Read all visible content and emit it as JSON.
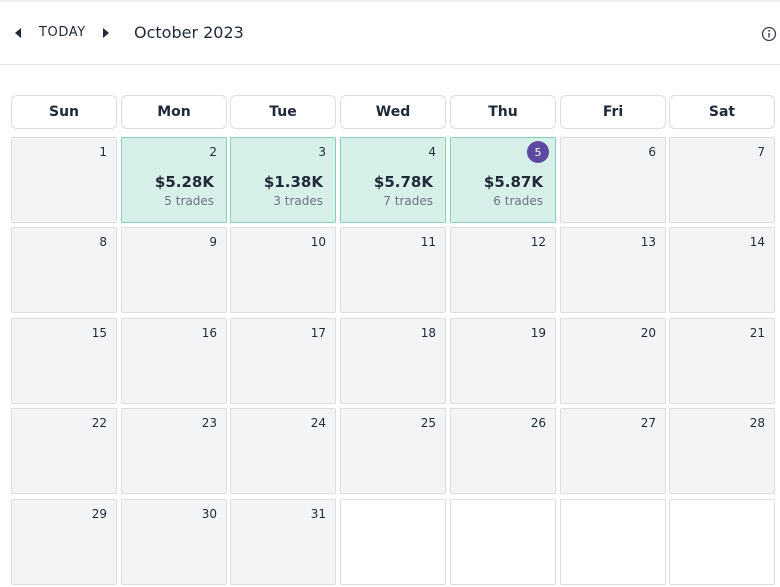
{
  "toolbar": {
    "prev_icon": "chevron-left-icon",
    "today_label": "TODAY",
    "next_icon": "chevron-right-icon",
    "month_title": "October 2023",
    "info_icon": "info-icon"
  },
  "weekdays": [
    "Sun",
    "Mon",
    "Tue",
    "Wed",
    "Thu",
    "Fri",
    "Sat"
  ],
  "colors": {
    "profit_bg": "#d7f1ea",
    "profit_border": "#86cfb3",
    "today_badge": "#5b4aa0",
    "cell_bg": "#f3f4f6"
  },
  "weeks": [
    [
      {
        "day": "1"
      },
      {
        "day": "2",
        "pnl": "$5.28K",
        "trades": "5 trades"
      },
      {
        "day": "3",
        "pnl": "$1.38K",
        "trades": "3 trades"
      },
      {
        "day": "4",
        "pnl": "$5.78K",
        "trades": "7 trades"
      },
      {
        "day": "5",
        "pnl": "$5.87K",
        "trades": "6 trades",
        "today": true
      },
      {
        "day": "6"
      },
      {
        "day": "7"
      }
    ],
    [
      {
        "day": "8"
      },
      {
        "day": "9"
      },
      {
        "day": "10"
      },
      {
        "day": "11"
      },
      {
        "day": "12"
      },
      {
        "day": "13"
      },
      {
        "day": "14"
      }
    ],
    [
      {
        "day": "15"
      },
      {
        "day": "16"
      },
      {
        "day": "17"
      },
      {
        "day": "18"
      },
      {
        "day": "19"
      },
      {
        "day": "20"
      },
      {
        "day": "21"
      }
    ],
    [
      {
        "day": "22"
      },
      {
        "day": "23"
      },
      {
        "day": "24"
      },
      {
        "day": "25"
      },
      {
        "day": "26"
      },
      {
        "day": "27"
      },
      {
        "day": "28"
      }
    ],
    [
      {
        "day": "29"
      },
      {
        "day": "30"
      },
      {
        "day": "31"
      },
      {
        "day": ""
      },
      {
        "day": ""
      },
      {
        "day": ""
      },
      {
        "day": ""
      }
    ]
  ]
}
